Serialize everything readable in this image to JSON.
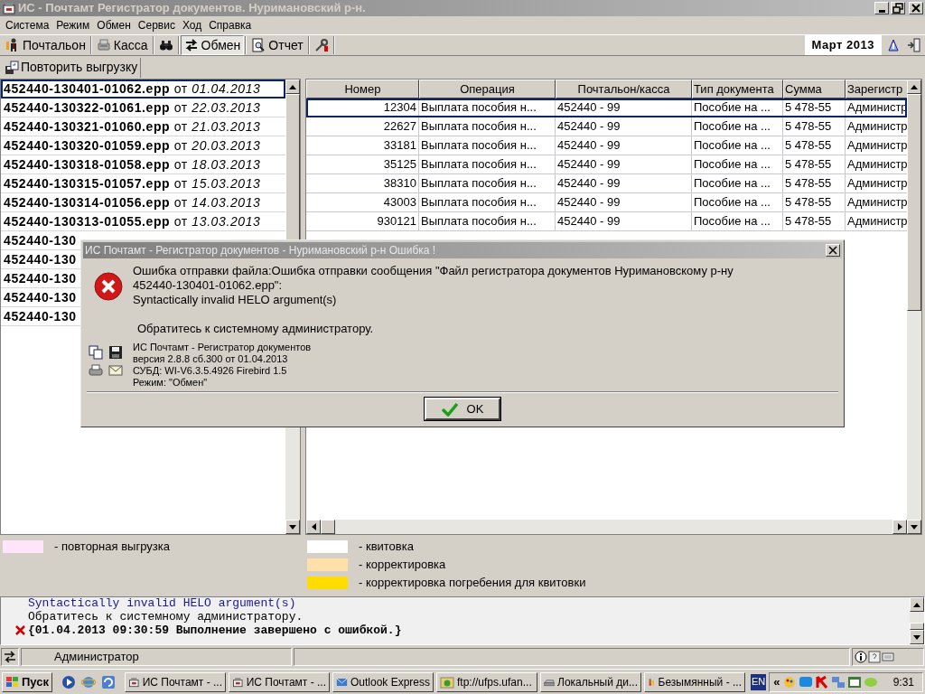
{
  "window": {
    "title": "ИС - Почтамт Регистратор документов. Нуримановский р-н."
  },
  "menu": [
    "Система",
    "Режим",
    "Обмен",
    "Сервис",
    "Ход",
    "Справка"
  ],
  "toolbar": [
    {
      "kind": "button",
      "label": "Почтальон",
      "selected": false
    },
    {
      "kind": "button",
      "label": "Касса",
      "selected": false
    },
    {
      "kind": "icon",
      "selected": false
    },
    {
      "kind": "button",
      "label": "Обмен",
      "selected": true
    },
    {
      "kind": "button",
      "label": "Отчет",
      "selected": false
    },
    {
      "kind": "icon",
      "selected": false
    }
  ],
  "period": "Март 2013",
  "subtoolbar": [
    "Повторить выгрузку"
  ],
  "files": [
    {
      "label": "**452440-130401-01062.epp** от *01.04.2013*",
      "selected": true
    },
    {
      "label": "**452440-130322-01061.epp** от *22.03.2013*",
      "selected": false
    },
    {
      "label": "**452440-130321-01060.epp** от *21.03.2013*",
      "selected": false
    },
    {
      "label": "**452440-130320-01059.epp** от *20.03.2013*",
      "selected": false
    },
    {
      "label": "**452440-130318-01058.epp** от *18.03.2013*",
      "selected": false
    },
    {
      "label": "**452440-130315-01057.epp** от *15.03.2013*",
      "selected": false
    },
    {
      "label": "**452440-130314-01056.epp** от *14.03.2013*",
      "selected": false
    },
    {
      "label": "**452440-130313-01055.epp** от *13.03.2013*",
      "selected": false
    },
    {
      "label": "**452440-130**",
      "selected": false
    },
    {
      "label": "**452440-130**",
      "selected": false
    },
    {
      "label": "**452440-130**",
      "selected": false
    },
    {
      "label": "**452440-130**",
      "selected": false
    },
    {
      "label": "**452440-130**",
      "selected": false
    }
  ],
  "table": {
    "columns": [
      "Номер",
      "Операция",
      "Почтальон/касса",
      "Тип документа",
      "Сумма",
      "Зарегистр"
    ],
    "rows": [
      {
        "cells": [
          "12304",
          "Выплата пособия н...",
          "452440 - 99",
          "Пособие на ...",
          "5 478-55",
          "Администр"
        ],
        "selected": true
      },
      {
        "cells": [
          "22627",
          "Выплата пособия н...",
          "452440 - 99",
          "Пособие на ...",
          "5 478-55",
          "Администр"
        ],
        "selected": false
      },
      {
        "cells": [
          "33181",
          "Выплата пособия н...",
          "452440 - 99",
          "Пособие на ...",
          "5 478-55",
          "Администр"
        ],
        "selected": false
      },
      {
        "cells": [
          "35125",
          "Выплата пособия н...",
          "452440 - 99",
          "Пособие на ...",
          "5 478-55",
          "Администр"
        ],
        "selected": false
      },
      {
        "cells": [
          "38310",
          "Выплата пособия н...",
          "452440 - 99",
          "Пособие на ...",
          "5 478-55",
          "Администр"
        ],
        "selected": false
      },
      {
        "cells": [
          "43003",
          "Выплата пособия н...",
          "452440 - 99",
          "Пособие на ...",
          "5 478-55",
          "Администр"
        ],
        "selected": false
      },
      {
        "cells": [
          "930121",
          "Выплата пособия н...",
          "452440 - 99",
          "Пособие на ...",
          "5 478-55",
          "Администр"
        ],
        "selected": false
      }
    ]
  },
  "legend": {
    "left": [
      {
        "label": "- повторная выгрузка",
        "color": "#ffe4fa"
      }
    ],
    "right": [
      {
        "label": "- квитовка",
        "color": "#ffffff"
      },
      {
        "label": "- корректировка",
        "color": "#ffe0a8"
      },
      {
        "label": "- корректировка погребения для квитовки",
        "color": "#ffdc00"
      }
    ]
  },
  "log": [
    {
      "kind": "info",
      "text": "Syntactically invalid HELO argument(s)"
    },
    {
      "kind": "plain",
      "text": "Обратитесь к системному администратору."
    },
    {
      "kind": "error",
      "text": "{01.04.2013 09:30:59 Выполнение завершено с ошибкой.}"
    }
  ],
  "status_bar": {
    "user": "Администратор"
  },
  "dialog": {
    "title": "ИС Почтамт - Регистратор документов - Нуримановский р-н Ошибка !",
    "message": [
      "Ошибка отправки файла:Ошибка отправки сообщения \"Файл регистратора документов Нуримановскому р-ну",
      "452440-130401-01062.epp\":",
      "Syntactically invalid HELO argument(s)"
    ],
    "advice": "Обратитесь к системному администратору.",
    "info": [
      "ИС Почтамт - Регистратор документов",
      "версия 2.8.8 сб.300 от 01.04.2013",
      "СУБД: WI-V6.3.5.4926 Firebird 1.5",
      "Режим: \"Обмен\""
    ],
    "button": "OK"
  },
  "taskbar": {
    "start": "Пуск",
    "tasks": [
      "ИС Почтамт - ...",
      "ИС Почтамт - ...",
      "Outlook Express",
      "ftp://ufps.ufan...",
      "Локальный ди...",
      "Безымянный - ..."
    ],
    "language": "EN",
    "expand": "«",
    "clock": "9:31"
  }
}
